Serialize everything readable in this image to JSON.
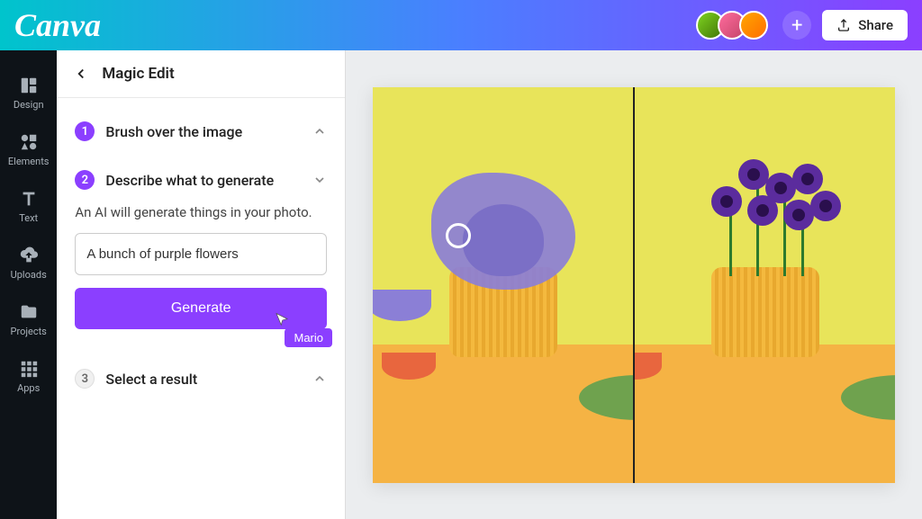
{
  "header": {
    "logo": "Canva",
    "share_label": "Share"
  },
  "sidebar": {
    "items": [
      {
        "label": "Design"
      },
      {
        "label": "Elements"
      },
      {
        "label": "Text"
      },
      {
        "label": "Uploads"
      },
      {
        "label": "Projects"
      },
      {
        "label": "Apps"
      }
    ]
  },
  "panel": {
    "title": "Magic Edit",
    "steps": [
      {
        "num": "1",
        "label": "Brush over the image"
      },
      {
        "num": "2",
        "label": "Describe what to generate"
      },
      {
        "num": "3",
        "label": "Select a result"
      }
    ],
    "help_text": "An AI will generate things in your photo.",
    "prompt_value": "A bunch of purple flowers",
    "generate_label": "Generate",
    "cursor_user": "Mario"
  },
  "colors": {
    "accent": "#8B3FFF",
    "brush_overlay": "#8B7FD6"
  }
}
